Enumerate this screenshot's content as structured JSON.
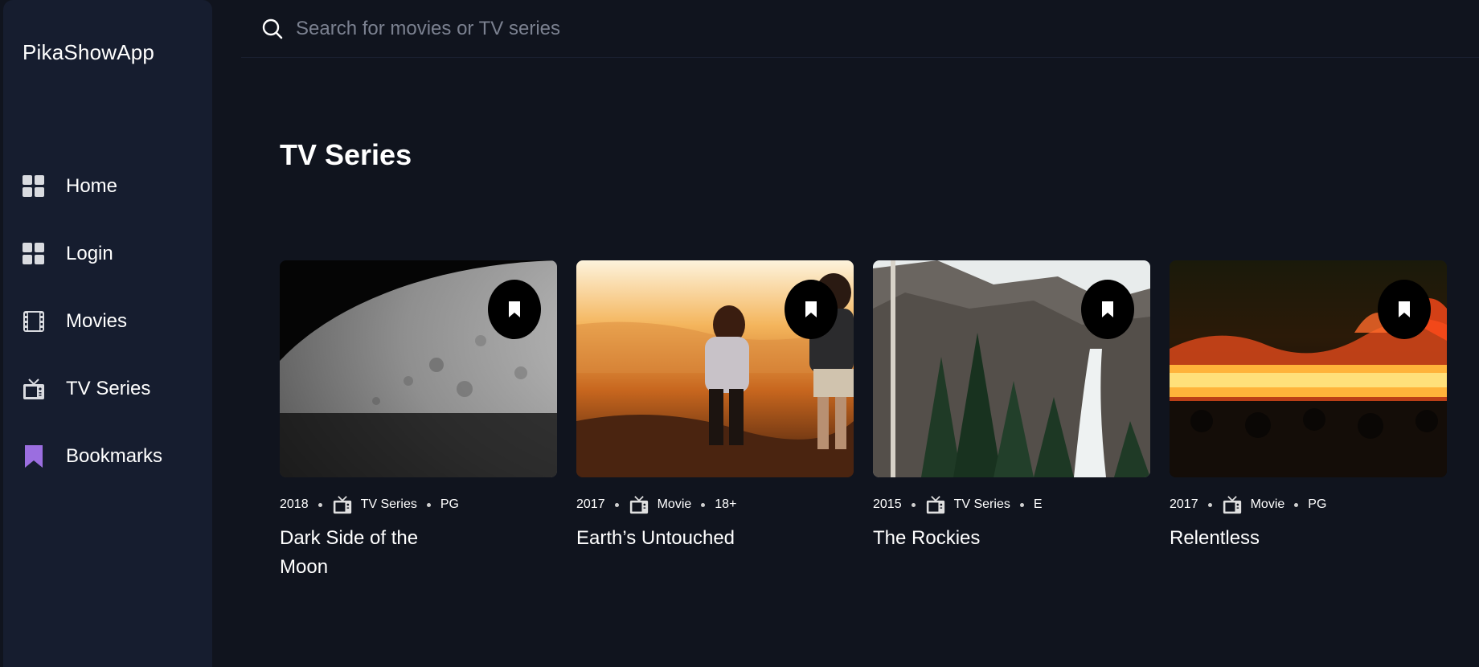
{
  "brand": "PikaShowApp",
  "nav": [
    {
      "label": "Home",
      "icon": "grid-icon"
    },
    {
      "label": "Login",
      "icon": "grid-icon"
    },
    {
      "label": "Movies",
      "icon": "film-icon"
    },
    {
      "label": "TV Series",
      "icon": "tv-icon"
    },
    {
      "label": "Bookmarks",
      "icon": "bookmark-icon"
    }
  ],
  "search": {
    "placeholder": "Search for movies or TV series"
  },
  "section_title": "TV Series",
  "cards": [
    {
      "year": "2018",
      "type": "TV Series",
      "rating": "PG",
      "title": "Dark Side of the Moon"
    },
    {
      "year": "2017",
      "type": "Movie",
      "rating": "18+",
      "title": "Earth’s Untouched"
    },
    {
      "year": "2015",
      "type": "TV Series",
      "rating": "E",
      "title": "The Rockies"
    },
    {
      "year": "2017",
      "type": "Movie",
      "rating": "PG",
      "title": "Relentless"
    }
  ],
  "colors": {
    "background": "#10141e",
    "sidebar": "#161d2f",
    "accent": "#9b6ee0",
    "text": "#ffffff",
    "placeholder": "#7b8190"
  }
}
